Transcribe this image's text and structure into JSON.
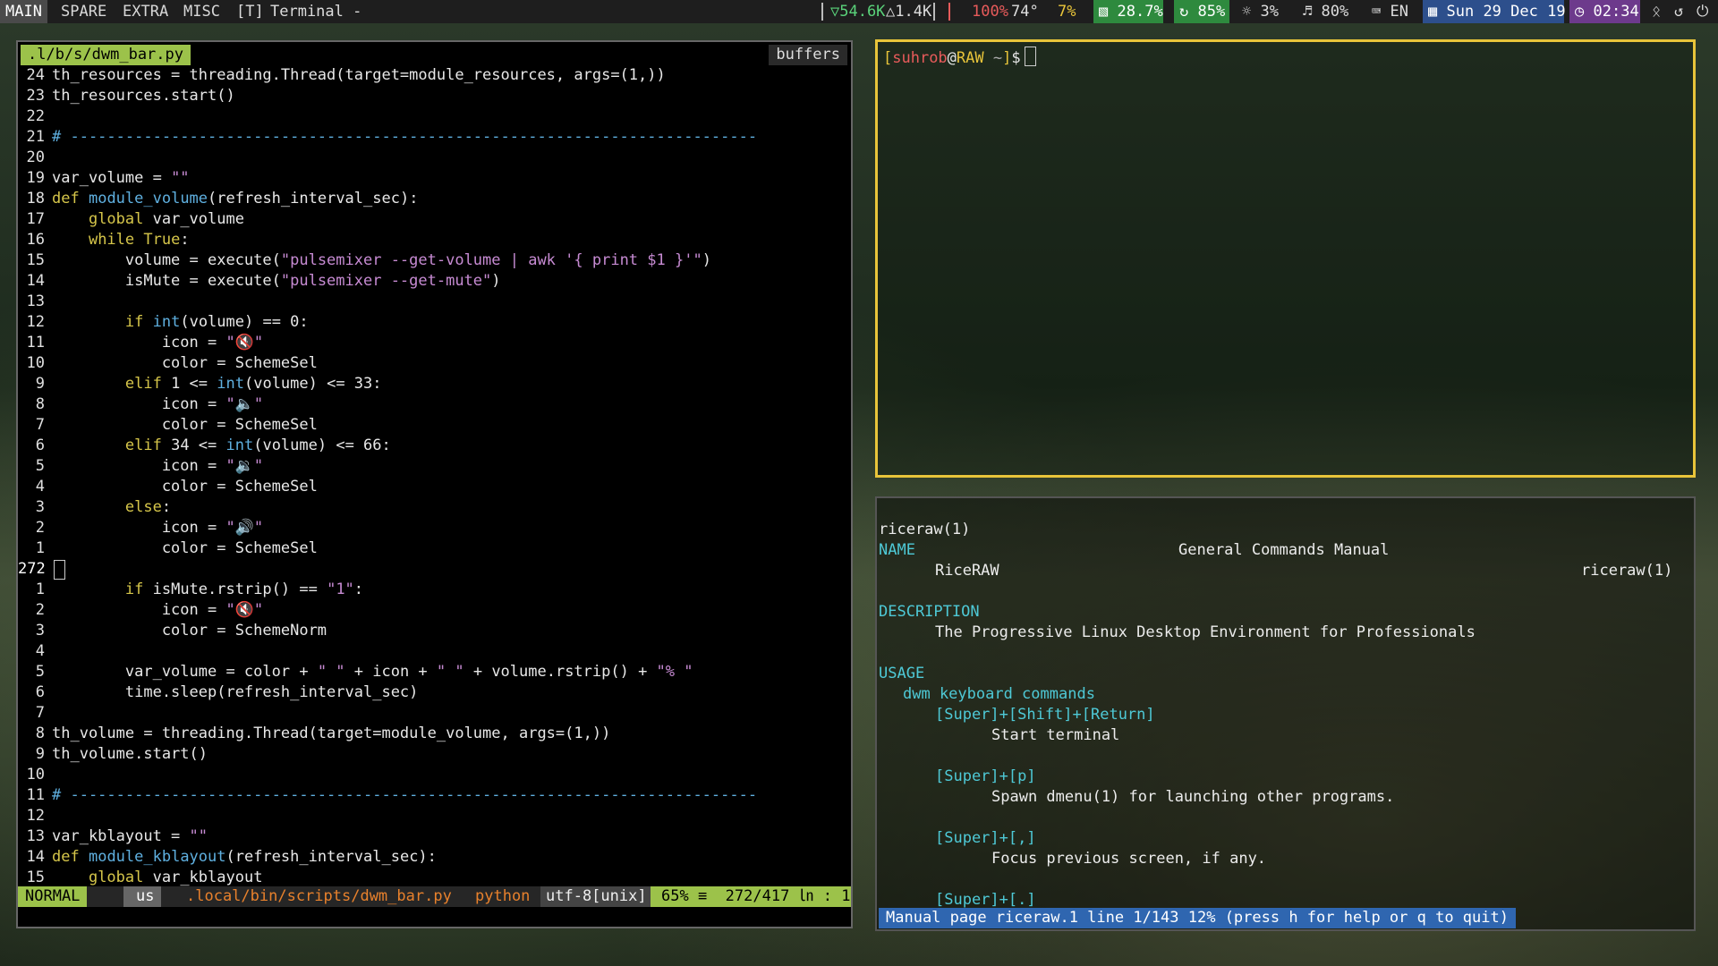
{
  "topbar": {
    "tags": [
      "MAIN",
      "SPARE",
      "EXTRA",
      "MISC"
    ],
    "active_tag": "MAIN",
    "layout": "[T]",
    "window_title": "Terminal -",
    "net_down": "▽54.6K",
    "net_up": "△1.4K",
    "cpu": "100%",
    "temp": "74°",
    "gpu": "7%",
    "disk": "28.7%",
    "memory": "85%",
    "brightness": "3%",
    "volume": "80%",
    "kb_layout": "EN",
    "date": "Sun 29 Dec 19",
    "time": "02:34",
    "colors": {
      "disk": "#2e8a3e",
      "memory": "#2e8a3e",
      "date": "#2d4f8c",
      "time": "#6d3a8c",
      "cpu": "#b8323a"
    }
  },
  "vim": {
    "tab_label": ".l/b/s/dwm_bar.py",
    "buffers_label": "buffers",
    "lines": [
      {
        "n": "24",
        "t": "th_resources = threading.Thread(target=module_resources, args=(1,))"
      },
      {
        "n": "23",
        "t": "th_resources.start()"
      },
      {
        "n": "22",
        "t": ""
      },
      {
        "n": "21",
        "t": "# ---------------------------------------------------------------------------"
      },
      {
        "n": "20",
        "t": ""
      },
      {
        "n": "19",
        "t": "var_volume = \"\""
      },
      {
        "n": "18",
        "t": "def module_volume(refresh_interval_sec):"
      },
      {
        "n": "17",
        "t": "    global var_volume"
      },
      {
        "n": "16",
        "t": "    while True:"
      },
      {
        "n": "15",
        "t": "        volume = execute(\"pulsemixer --get-volume | awk '{ print $1 }'\")"
      },
      {
        "n": "14",
        "t": "        isMute = execute(\"pulsemixer --get-mute\")"
      },
      {
        "n": "13",
        "t": ""
      },
      {
        "n": "12",
        "t": "        if int(volume) == 0:"
      },
      {
        "n": "11",
        "t": "            icon = \"🔇\""
      },
      {
        "n": "10",
        "t": "            color = SchemeSel"
      },
      {
        "n": "9",
        "t": "        elif 1 <= int(volume) <= 33:"
      },
      {
        "n": "8",
        "t": "            icon = \"🔈\""
      },
      {
        "n": "7",
        "t": "            color = SchemeSel"
      },
      {
        "n": "6",
        "t": "        elif 34 <= int(volume) <= 66:"
      },
      {
        "n": "5",
        "t": "            icon = \"🔉\""
      },
      {
        "n": "4",
        "t": "            color = SchemeSel"
      },
      {
        "n": "3",
        "t": "        else:"
      },
      {
        "n": "2",
        "t": "            icon = \"🔊\""
      },
      {
        "n": "1",
        "t": "            color = SchemeSel"
      },
      {
        "n": "272",
        "t": "",
        "cursor": true
      },
      {
        "n": "1",
        "t": "        if isMute.rstrip() == \"1\":"
      },
      {
        "n": "2",
        "t": "            icon = \"🔇\""
      },
      {
        "n": "3",
        "t": "            color = SchemeNorm"
      },
      {
        "n": "4",
        "t": ""
      },
      {
        "n": "5",
        "t": "        var_volume = color + \" \" + icon + \" \" + volume.rstrip() + \"% \""
      },
      {
        "n": "6",
        "t": "        time.sleep(refresh_interval_sec)"
      },
      {
        "n": "7",
        "t": ""
      },
      {
        "n": "8",
        "t": "th_volume = threading.Thread(target=module_volume, args=(1,))"
      },
      {
        "n": "9",
        "t": "th_volume.start()"
      },
      {
        "n": "10",
        "t": ""
      },
      {
        "n": "11",
        "t": "# ---------------------------------------------------------------------------"
      },
      {
        "n": "12",
        "t": ""
      },
      {
        "n": "13",
        "t": "var_kblayout = \"\""
      },
      {
        "n": "14",
        "t": "def module_kblayout(refresh_interval_sec):"
      },
      {
        "n": "15",
        "t": "    global var_kblayout"
      }
    ],
    "status": {
      "mode": "NORMAL",
      "lang": "us",
      "path": ".local/bin/scripts/dwm_bar.py",
      "filetype": "python",
      "encoding": "utf-8[unix]",
      "percent": "65% ≡",
      "position": "272/417 ㏑ :  1"
    }
  },
  "terminal": {
    "user": "suhrob",
    "host": "RAW",
    "dir": "~"
  },
  "man": {
    "header_left": "riceraw(1)",
    "header_center": "General Commands Manual",
    "header_right": "riceraw(1)",
    "name_head": "NAME",
    "name_text": "RiceRAW",
    "desc_head": "DESCRIPTION",
    "desc_text": "The Progressive Linux Desktop Environment for Professionals",
    "usage_head": "USAGE",
    "usage_sub": "dwm keyboard commands",
    "commands": [
      {
        "keys": "[Super]+[Shift]+[Return]",
        "desc": "Start terminal"
      },
      {
        "keys": "[Super]+[p]",
        "desc": "Spawn dmenu(1) for launching other programs."
      },
      {
        "keys": "[Super]+[,]",
        "desc": "Focus previous screen, if any."
      },
      {
        "keys": "[Super]+[.]",
        "desc": ""
      }
    ],
    "status_line": "Manual page riceraw.1 line 1/143 12% (press h for help or q to quit)"
  }
}
